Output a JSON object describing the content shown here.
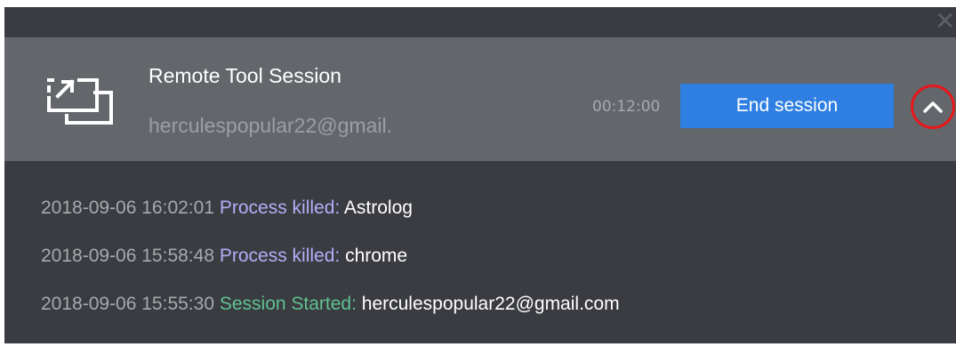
{
  "window": {
    "close_glyph": "✕"
  },
  "session": {
    "title": "Remote Tool Session",
    "email": "herculespopular22@gmail.",
    "timer": "00:12:00",
    "end_button_label": "End session",
    "icon": "remote-session-icon",
    "collapse_icon": "chevron-up-icon"
  },
  "log": [
    {
      "timestamp": "2018-09-06 16:02:01",
      "event": "Process killed:",
      "detail": "Astrolog",
      "type": "killed"
    },
    {
      "timestamp": "2018-09-06 15:58:48",
      "event": "Process killed:",
      "detail": "chrome",
      "type": "killed"
    },
    {
      "timestamp": "2018-09-06 15:55:30",
      "event": "Session Started:",
      "detail": "herculespopular22@gmail.com",
      "type": "started"
    }
  ],
  "colors": {
    "panel_bg": "#3a3c42",
    "header_bg": "#63666b",
    "accent_button": "#2f7fe3",
    "highlight_circle": "#e8171b",
    "event_killed": "#b3aef6",
    "event_started": "#5fc18f"
  }
}
